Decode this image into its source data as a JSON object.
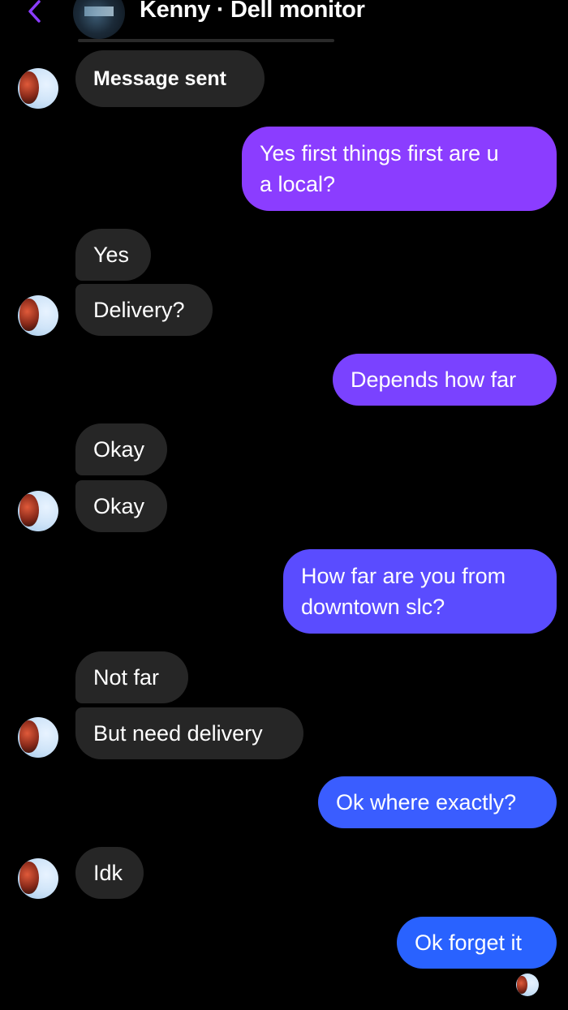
{
  "header": {
    "title": "Kenny · Dell monitor",
    "back_icon": "chevron-left-icon",
    "accent_color": "#8b3dff"
  },
  "messages": [
    {
      "side": "in",
      "text": "Message sent"
    },
    {
      "side": "out",
      "text": "Yes first things first are u\na local?"
    },
    {
      "side": "in",
      "text": "Yes"
    },
    {
      "side": "in",
      "text": "Delivery?"
    },
    {
      "side": "out",
      "text": "Depends how far"
    },
    {
      "side": "in",
      "text": "Okay"
    },
    {
      "side": "in",
      "text": "Okay"
    },
    {
      "side": "out",
      "text": "How far are you from\ndowntown slc?"
    },
    {
      "side": "in",
      "text": "Not far"
    },
    {
      "side": "in",
      "text": "But need delivery"
    },
    {
      "side": "out",
      "text": "Ok where exactly?"
    },
    {
      "side": "in",
      "text": "Idk"
    },
    {
      "side": "out",
      "text": "Ok forget it"
    }
  ],
  "colors": {
    "incoming_bubble": "#262626",
    "outgoing_gradient_top": "#8b3dff",
    "outgoing_gradient_bottom": "#2962ff",
    "background": "#000000"
  }
}
